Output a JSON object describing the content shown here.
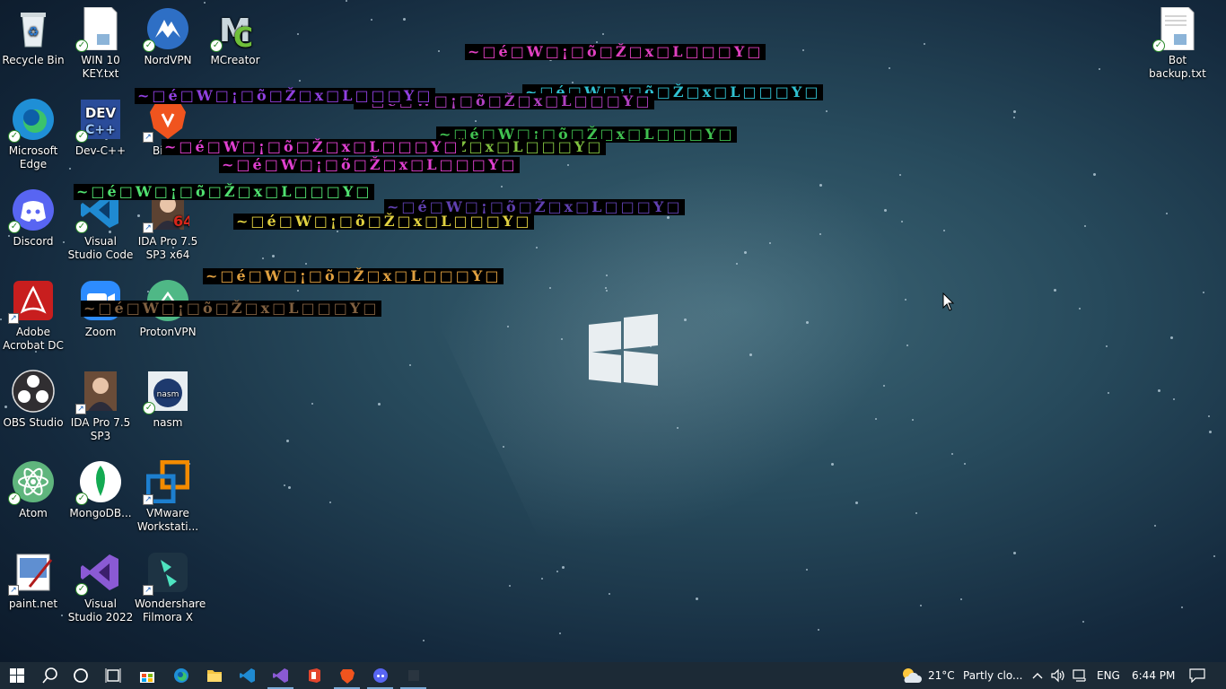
{
  "desktop": {
    "icons": [
      {
        "label": "Recycle Bin",
        "icon": "recycle-bin-icon"
      },
      {
        "label": "WIN 10 KEY.txt",
        "icon": "text-file-icon"
      },
      {
        "label": "NordVPN",
        "icon": "nordvpn-icon"
      },
      {
        "label": "MCreator",
        "icon": "mcreator-icon"
      },
      {
        "label": "Microsoft Edge",
        "icon": "edge-icon"
      },
      {
        "label": "Dev-C++",
        "icon": "devcpp-icon"
      },
      {
        "label": "Bi",
        "icon": "brave-icon"
      },
      {
        "label": "Discord",
        "icon": "discord-icon"
      },
      {
        "label": "Visual Studio Code",
        "icon": "vscode-icon"
      },
      {
        "label": "IDA Pro 7.5 SP3 x64",
        "icon": "ida-pro-icon"
      },
      {
        "label": "Adobe Acrobat DC",
        "icon": "acrobat-icon"
      },
      {
        "label": "Zoom",
        "icon": "zoom-icon"
      },
      {
        "label": "ProtonVPN",
        "icon": "protonvpn-icon"
      },
      {
        "label": "OBS Studio",
        "icon": "obs-icon"
      },
      {
        "label": "IDA Pro 7.5 SP3",
        "icon": "ida-pro-icon"
      },
      {
        "label": "nasm",
        "icon": "nasm-icon"
      },
      {
        "label": "Atom",
        "icon": "atom-icon"
      },
      {
        "label": "MongoDB...",
        "icon": "mongodb-icon"
      },
      {
        "label": "VMware Workstati...",
        "icon": "vmware-icon"
      },
      {
        "label": "paint.net",
        "icon": "paintnet-icon"
      },
      {
        "label": "Visual Studio 2022",
        "icon": "visual-studio-icon"
      },
      {
        "label": "Wondershare Filmora X",
        "icon": "filmora-icon"
      },
      {
        "label": "Bot backup.txt",
        "icon": "text-file-icon"
      }
    ],
    "glitch_text": "~□é□W□¡□õ□Ž□x□L□□□Y□",
    "glitch_colors": [
      "#e040c0",
      "#9040e0",
      "#30c0d0",
      "#40c050",
      "#e040d0",
      "#50e070",
      "#6040b0",
      "#e0d040",
      "#e0a040",
      "#806040"
    ]
  },
  "taskbar": {
    "apps": [
      {
        "name": "start-button",
        "icon": "windows-icon"
      },
      {
        "name": "search-button",
        "icon": "search-icon"
      },
      {
        "name": "cortana-button",
        "icon": "cortana-icon"
      },
      {
        "name": "task-view-button",
        "icon": "task-view-icon"
      },
      {
        "name": "store-app",
        "icon": "store-icon"
      },
      {
        "name": "edge-app",
        "icon": "edge-icon"
      },
      {
        "name": "explorer-app",
        "icon": "folder-icon"
      },
      {
        "name": "vscode-app",
        "icon": "vscode-icon"
      },
      {
        "name": "visual-studio-app",
        "icon": "visual-studio-icon"
      },
      {
        "name": "office-app",
        "icon": "office-icon"
      },
      {
        "name": "brave-app",
        "icon": "brave-icon"
      },
      {
        "name": "discord-app",
        "icon": "discord-icon"
      },
      {
        "name": "blank-app",
        "icon": "app-icon"
      }
    ],
    "weather": {
      "temp": "21°C",
      "desc": "Partly clo..."
    },
    "language": "ENG",
    "time": "6:44 PM"
  },
  "colors": {
    "taskbar": "#1c2a36",
    "accent": "#7aaad6"
  }
}
